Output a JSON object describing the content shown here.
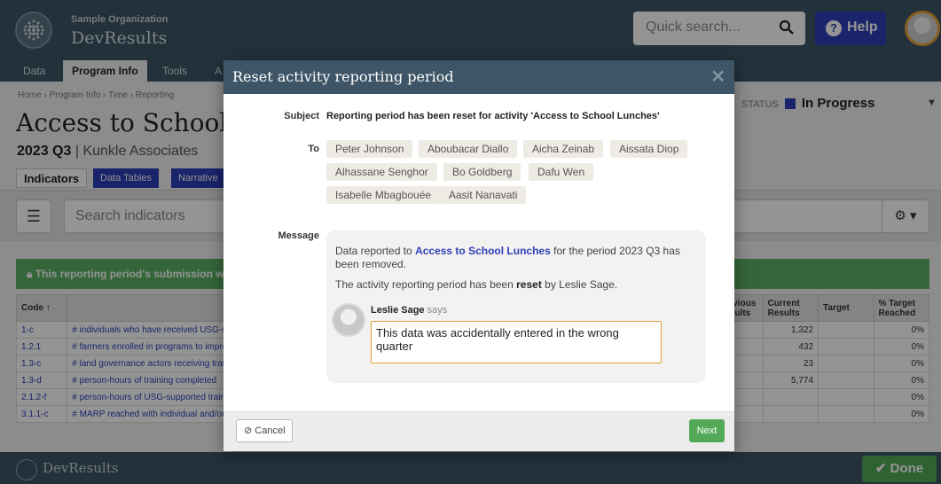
{
  "header": {
    "org_name": "Sample Organization",
    "app_name": "DevResults",
    "search_placeholder": "Quick search...",
    "help_label": "Help"
  },
  "nav": {
    "tabs": [
      "Data",
      "Program Info",
      "Tools",
      "A"
    ]
  },
  "page": {
    "breadcrumb": [
      "Home",
      "Program Info",
      "Time",
      "Reporting"
    ],
    "title": "Access to School Lunches",
    "period": "2023 Q3",
    "org": "Kunkle Associates",
    "status_label": "STATUS",
    "status_value": "In Progress",
    "subtabs": [
      "Indicators",
      "Data Tables",
      "Narrative"
    ],
    "search_placeholder": "Search indicators",
    "alert": "This reporting period's submission was reset"
  },
  "table": {
    "headers": [
      "Code",
      "",
      "Previous Results",
      "Current Results",
      "Target",
      "% Target Reached"
    ],
    "rows": [
      {
        "code": "1-c",
        "name": "# individuals who have received USG-supported",
        "current": "1,322",
        "pct": "0%"
      },
      {
        "code": "1.2.1",
        "name": "# farmers enrolled in programs to improve",
        "current": "432",
        "pct": "0%"
      },
      {
        "code": "1.3-c",
        "name": "# land governance actors receiving training",
        "current": "23",
        "pct": "0%"
      },
      {
        "code": "1.3-d",
        "name": "# person-hours of training completed",
        "current": "5,774",
        "pct": "0%"
      },
      {
        "code": "2.1.2-f",
        "name": "# person-hours of USG-supported training",
        "current": "",
        "pct": "0%"
      },
      {
        "code": "3.1.1-c",
        "name": "# MARP reached with individual and/or",
        "current": "",
        "pct": "0%"
      }
    ]
  },
  "footer": {
    "app_name": "DevResults",
    "done_label": "Done"
  },
  "modal": {
    "title": "Reset activity reporting period",
    "subject_label": "Subject",
    "subject": "Reporting period has been reset for activity 'Access to School Lunches'",
    "to_label": "To",
    "recipients": [
      "Peter Johnson",
      "Aboubacar Diallo",
      "Aicha Zeinab",
      "Aissata Diop",
      "Alhassane Senghor",
      "Bo Goldberg",
      "Dafu Wen",
      "Isabelle Mbagbouée",
      "Aasit Nanavati"
    ],
    "message_label": "Message",
    "msg_pre": "Data reported to ",
    "msg_link": "Access to School Lunches",
    "msg_post": " for the period 2023 Q3 has been removed.",
    "msg2_pre": "The activity reporting period has been ",
    "msg2_bold": "reset",
    "msg2_post": " by Leslie Sage.",
    "commenter": "Leslie Sage",
    "says": "says",
    "comment": "This data was accidentally entered in the wrong quarter",
    "cancel_label": "Cancel",
    "next_label": "Next"
  },
  "colors": {
    "header_bg": "#3d5566",
    "accent_blue": "#2e3fb7",
    "success_green": "#52a957",
    "focus_orange": "#e0a040"
  }
}
